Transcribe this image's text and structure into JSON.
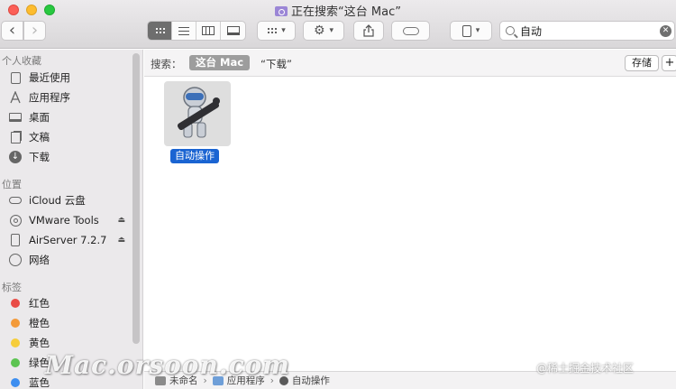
{
  "window": {
    "title": "正在搜索“这台 Mac”"
  },
  "toolbar": {
    "back": "‹",
    "forward": "›",
    "search_value": "自动",
    "clear": "✕"
  },
  "sidebar": {
    "favorites_header": "个人收藏",
    "favorites": [
      {
        "label": "最近使用",
        "icon": "recents-icon"
      },
      {
        "label": "应用程序",
        "icon": "applications-icon"
      },
      {
        "label": "桌面",
        "icon": "desktop-icon"
      },
      {
        "label": "文稿",
        "icon": "documents-icon"
      },
      {
        "label": "下载",
        "icon": "downloads-icon"
      }
    ],
    "locations_header": "位置",
    "locations": [
      {
        "label": "iCloud 云盘",
        "icon": "icloud-icon"
      },
      {
        "label": "VMware Tools",
        "icon": "disk-icon"
      },
      {
        "label": "AirServer 7.2.7",
        "icon": "disk-icon"
      },
      {
        "label": "网络",
        "icon": "network-icon"
      }
    ],
    "tags_header": "标签",
    "tags": [
      {
        "label": "红色",
        "color": "#e94b45"
      },
      {
        "label": "橙色",
        "color": "#f39a3a"
      },
      {
        "label": "黄色",
        "color": "#f6cd3b"
      },
      {
        "label": "绿色",
        "color": "#5cc451"
      },
      {
        "label": "蓝色",
        "color": "#3d8ef0"
      }
    ]
  },
  "scope": {
    "label": "搜索：",
    "active": "这台 Mac",
    "other": "“下载”",
    "save": "存储",
    "add": "+"
  },
  "results": [
    {
      "name": "自动操作",
      "icon": "automator-icon"
    }
  ],
  "pathbar": [
    "未命名",
    "应用程序",
    "自动操作"
  ],
  "watermark": {
    "main": "Mac.orsoon.com",
    "side": "@稀土掘金技术社区"
  }
}
